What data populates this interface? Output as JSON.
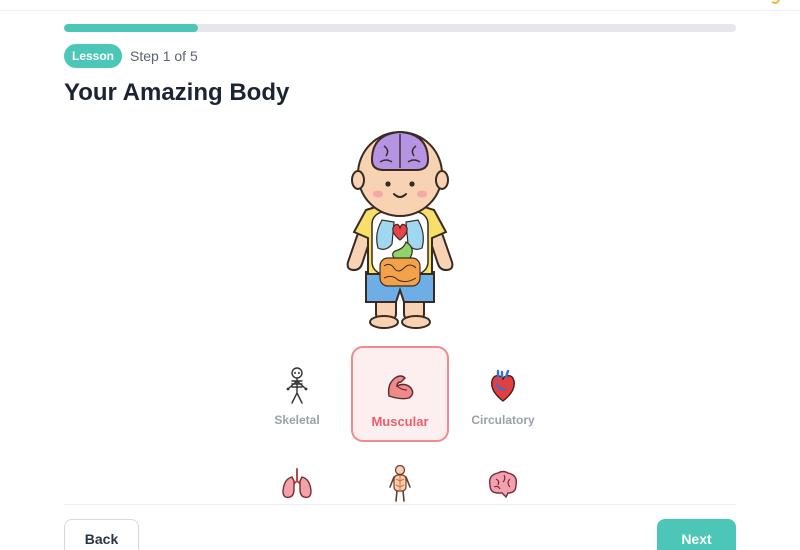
{
  "lesson": {
    "badge": "Lesson",
    "step_text": "Step 1 of 5",
    "progress": 0.2,
    "title": "Your Amazing Body"
  },
  "hero": {
    "icon": "body-systems-illustration"
  },
  "systems": [
    {
      "label": "Skeletal",
      "icon": "skeleton-icon",
      "selected": false
    },
    {
      "label": "Muscular",
      "icon": "muscle-icon",
      "selected": true
    },
    {
      "label": "Circulatory",
      "icon": "heart-icon",
      "selected": false
    },
    {
      "label": "",
      "icon": "lungs-icon",
      "selected": false
    },
    {
      "label": "",
      "icon": "nervous-system-icon",
      "selected": false
    },
    {
      "label": "",
      "icon": "brain-icon",
      "selected": false
    }
  ],
  "footer": {
    "back_label": "Back",
    "next_label": "Next"
  },
  "colors": {
    "accent": "#4cc7b7",
    "selected_border": "#f2898f",
    "selected_text": "#ea5f66"
  }
}
